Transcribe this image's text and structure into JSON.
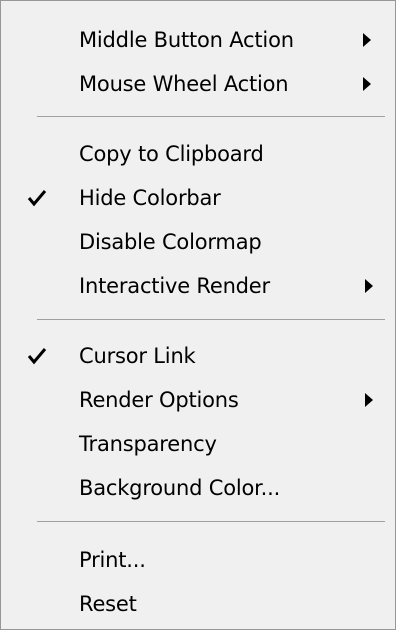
{
  "menu": {
    "items": [
      {
        "label": "Middle Button Action",
        "checked": false,
        "submenu": true,
        "icon": "chevron-right-icon"
      },
      {
        "label": "Mouse Wheel Action",
        "checked": false,
        "submenu": true,
        "icon": "chevron-right-icon"
      },
      {
        "label": "Copy to Clipboard",
        "checked": false,
        "submenu": false
      },
      {
        "label": "Hide Colorbar",
        "checked": true,
        "submenu": false,
        "icon": "checkmark-icon"
      },
      {
        "label": "Disable Colormap",
        "checked": false,
        "submenu": false
      },
      {
        "label": "Interactive Render",
        "checked": false,
        "submenu": true,
        "icon": "chevron-right-icon"
      },
      {
        "label": "Cursor Link",
        "checked": true,
        "submenu": false,
        "icon": "checkmark-icon"
      },
      {
        "label": "Render Options",
        "checked": false,
        "submenu": true,
        "icon": "chevron-right-icon"
      },
      {
        "label": "Transparency",
        "checked": false,
        "submenu": false
      },
      {
        "label": "Background Color...",
        "checked": false,
        "submenu": false
      },
      {
        "label": "Print...",
        "checked": false,
        "submenu": false
      },
      {
        "label": "Reset",
        "checked": false,
        "submenu": false
      }
    ],
    "colors": {
      "background": "#f0f0f0",
      "border": "#979797",
      "separator": "#a0a0a0",
      "text": "#000000"
    }
  }
}
